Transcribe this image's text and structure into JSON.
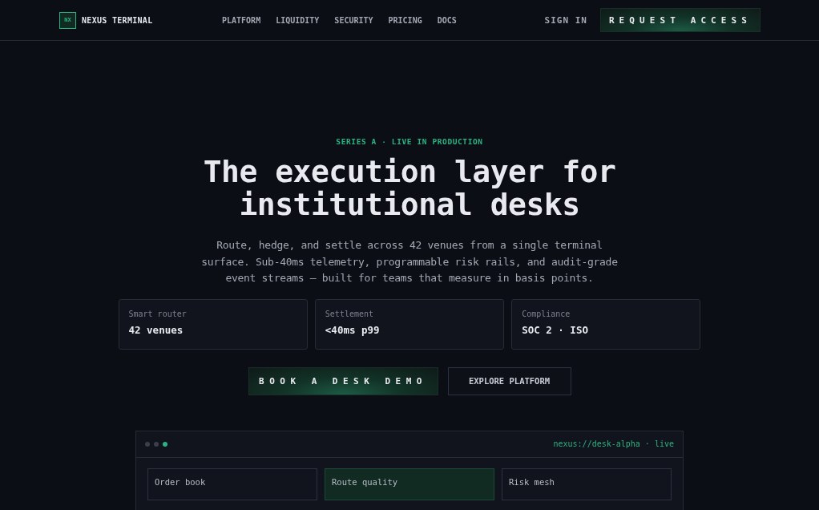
{
  "brand": {
    "mark": "NX",
    "name": "NEXUS TERMINAL"
  },
  "nav": [
    "PLATFORM",
    "LIQUIDITY",
    "SECURITY",
    "PRICING",
    "DOCS"
  ],
  "actions": {
    "sign_in": "SIGN IN",
    "request": "REQUEST ACCESS"
  },
  "hero": {
    "eyebrow": "SERIES A · LIVE IN PRODUCTION",
    "title": "The execution layer for institutional desks",
    "lead": "Route, hedge, and settle across 42 venues from a single terminal surface. Sub-40ms telemetry, programmable risk rails, and audit-grade event streams — built for teams that measure in basis points."
  },
  "stats": [
    {
      "label": "Smart router",
      "value": "42 venues"
    },
    {
      "label": "Settlement",
      "value": "<40ms p99"
    },
    {
      "label": "Compliance",
      "value": "SOC 2 · ISO"
    }
  ],
  "ctas": [
    {
      "label": "BOOK A DESK DEMO",
      "kind": "primary"
    },
    {
      "label": "EXPLORE PLATFORM",
      "kind": "secondary"
    }
  ],
  "terminal": {
    "dots": [
      {
        "color": "#3a3f4b"
      },
      {
        "color": "#3a3f4b"
      },
      {
        "color": "#2bb383"
      }
    ],
    "address": "nexus://desk-alpha · live",
    "panels": [
      {
        "title": "Order book",
        "selected": false
      },
      {
        "title": "Route quality",
        "selected": true
      },
      {
        "title": "Risk mesh",
        "selected": false
      }
    ]
  }
}
